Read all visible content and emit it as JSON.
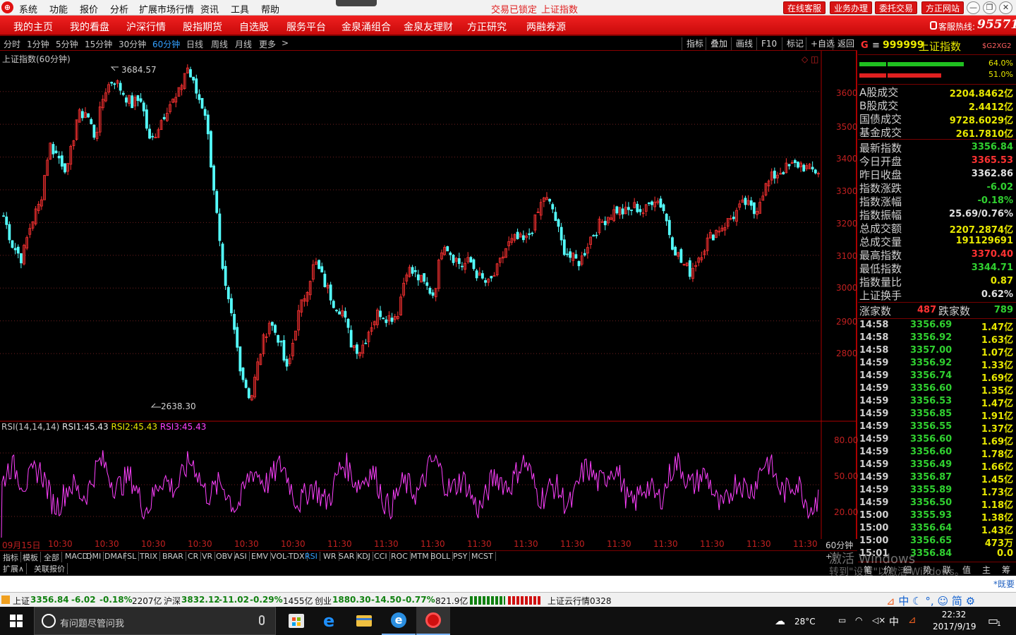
{
  "app": {
    "menu": [
      "系统",
      "功能",
      "报价",
      "分析",
      "扩展市场行情",
      "资讯",
      "工具",
      "帮助"
    ],
    "status_text": "交易已锁定",
    "index_name": "上证指数",
    "top_buttons": [
      "在线客服",
      "业务办理",
      "委托交易",
      "方正网站"
    ],
    "window_buttons": [
      "minimize",
      "restore",
      "close"
    ]
  },
  "nav": {
    "items": [
      "我的主页",
      "我的看盘",
      "沪深行情",
      "股指期货",
      "自选股",
      "服务平台",
      "金泉涌组合",
      "金泉友理财",
      "方正研究",
      "两融券源"
    ],
    "hotline_label": "客服热线:",
    "hotline_number": "95571"
  },
  "periods": {
    "items": [
      "分时",
      "1分钟",
      "5分钟",
      "15分钟",
      "30分钟",
      "60分钟",
      "日线",
      "周线",
      "月线",
      "更多"
    ],
    "active": "60分钟",
    "more_arrow": ">"
  },
  "tools": [
    "指标",
    "叠加",
    "画线",
    "F10",
    "标记",
    "+自选",
    "返回"
  ],
  "chart": {
    "title": "上证指数(60分钟)",
    "high_label": "3684.57",
    "low_label": "2638.30",
    "price_ticks": [
      "3600",
      "3500",
      "3400",
      "3300",
      "3200",
      "3100",
      "3000",
      "2900",
      "2800"
    ],
    "rsi_ticks": [
      "80.00",
      "50.00",
      "20.00"
    ],
    "rsi_label": "RSI(14,14,14)",
    "rsi1_label": "RSI1:",
    "rsi1": "45.43",
    "rsi2_label": "RSI2:",
    "rsi2": "45.43",
    "rsi3_label": "RSI3:",
    "rsi3": "45.43",
    "x_first": "09月15日",
    "x_labels": [
      "10:30",
      "10:30",
      "10:30",
      "10:30",
      "10:30",
      "10:30",
      "11:30",
      "11:30",
      "11:30",
      "11:30",
      "11:30",
      "11:30",
      "11:30",
      "11:30",
      "11:30",
      "11:30",
      "11:30"
    ],
    "x_period": "60分钟",
    "up_color": "#ff3232",
    "down_color": "#54ffff",
    "rsi_color": "#ff40ff"
  },
  "chart_data": {
    "type": "candlestick",
    "title": "上证指数(60分钟)",
    "ylim": [
      2600,
      3720
    ],
    "labeled_high": 3684.57,
    "labeled_low": 2638.3,
    "close_path": [
      3220,
      3130,
      3090,
      3200,
      3260,
      3440,
      3400,
      3360,
      3520,
      3540,
      3460,
      3600,
      3640,
      3600,
      3560,
      3580,
      3440,
      3500,
      3560,
      3580,
      3680,
      3600,
      3540,
      3300,
      3020,
      2900,
      2740,
      2660,
      2800,
      2900,
      2850,
      2740,
      2900,
      2990,
      3080,
      3020,
      2960,
      2930,
      2830,
      2810,
      2880,
      2930,
      2910,
      2920,
      3060,
      3040,
      3010,
      2980,
      3150,
      3100,
      3070,
      3080,
      3030,
      3010,
      3060,
      3130,
      3150,
      3140,
      3200,
      3280,
      3240,
      3130,
      3090,
      3080,
      3150,
      3190,
      3220,
      3240,
      3230,
      3250,
      3230,
      3280,
      3250,
      3140,
      3080,
      3050,
      3100,
      3150,
      3180,
      3200,
      3230,
      3260,
      3230,
      3300,
      3340,
      3360,
      3370,
      3380,
      3360,
      3356.84
    ],
    "rsi": {
      "ylim": [
        0,
        100
      ],
      "ticks": [
        20,
        50,
        80
      ],
      "current": 45.43
    }
  },
  "indicators": {
    "items": [
      "指标",
      "模板",
      "全部",
      "MACD",
      "DMI",
      "DMA",
      "FSL",
      "TRIX",
      "BRAR",
      "CR",
      "VR",
      "OBV",
      "ASI",
      "EMV",
      "VOL-TDX",
      "RSI",
      "WR",
      "SAR",
      "KDJ",
      "CCI",
      "ROC",
      "MTM",
      "BOLL",
      "PSY",
      "MCST"
    ],
    "active": "RSI",
    "plus": "+",
    "ext": [
      "扩展∧",
      "关联报价"
    ]
  },
  "right": {
    "code_prefix": "G",
    "code_menu": "≡",
    "code": "999999",
    "name": "上证指数",
    "badge": "$G2XG2",
    "bar1_value": "64.0%",
    "bar2_value": "51.0%",
    "volumes": [
      {
        "label": "A股成交",
        "value": "2204.8462亿"
      },
      {
        "label": "B股成交",
        "value": "2.4412亿"
      },
      {
        "label": "国债成交",
        "value": "9728.6029亿"
      },
      {
        "label": "基金成交",
        "value": "261.7810亿"
      }
    ],
    "stats": [
      {
        "label": "最新指数",
        "value": "3356.84",
        "color": "#30d030"
      },
      {
        "label": "今日开盘",
        "value": "3365.53",
        "color": "#ff3232"
      },
      {
        "label": "昨日收盘",
        "value": "3362.86",
        "color": "#e0e0e0"
      },
      {
        "label": "指数涨跌",
        "value": "-6.02",
        "color": "#30d030"
      },
      {
        "label": "指数涨幅",
        "value": "-0.18%",
        "color": "#30d030"
      },
      {
        "label": "指数振幅",
        "value": "25.69/0.76%",
        "color": "#e0e0e0"
      },
      {
        "label": "总成交额",
        "value": "2207.2874亿",
        "color": "#e8e800"
      },
      {
        "label": "总成交量",
        "value": "191129691",
        "color": "#e8e800"
      },
      {
        "label": "最高指数",
        "value": "3370.40",
        "color": "#ff3232"
      },
      {
        "label": "最低指数",
        "value": "3344.71",
        "color": "#30d030"
      },
      {
        "label": "指数量比",
        "value": "0.87",
        "color": "#e8e800"
      },
      {
        "label": "上证换手",
        "value": "0.62%",
        "color": "#e0e0e0"
      }
    ],
    "rise_label": "涨家数",
    "rise": "487",
    "fall_label": "跌家数",
    "fall": "789",
    "ticks": [
      {
        "t": "14:58",
        "p": "3356.69",
        "v": "1.47亿"
      },
      {
        "t": "14:58",
        "p": "3356.92",
        "v": "1.63亿"
      },
      {
        "t": "14:58",
        "p": "3357.00",
        "v": "1.07亿"
      },
      {
        "t": "14:59",
        "p": "3356.92",
        "v": "1.33亿"
      },
      {
        "t": "14:59",
        "p": "3356.74",
        "v": "1.69亿"
      },
      {
        "t": "14:59",
        "p": "3356.60",
        "v": "1.35亿"
      },
      {
        "t": "14:59",
        "p": "3356.53",
        "v": "1.47亿"
      },
      {
        "t": "14:59",
        "p": "3356.85",
        "v": "1.91亿"
      },
      {
        "t": "14:59",
        "p": "3356.55",
        "v": "1.37亿"
      },
      {
        "t": "14:59",
        "p": "3356.60",
        "v": "1.69亿"
      },
      {
        "t": "14:59",
        "p": "3356.60",
        "v": "1.78亿"
      },
      {
        "t": "14:59",
        "p": "3356.49",
        "v": "1.66亿"
      },
      {
        "t": "14:59",
        "p": "3356.87",
        "v": "1.45亿"
      },
      {
        "t": "14:59",
        "p": "3355.89",
        "v": "1.73亿"
      },
      {
        "t": "14:59",
        "p": "3356.50",
        "v": "1.18亿"
      },
      {
        "t": "15:00",
        "p": "3355.93",
        "v": "1.38亿"
      },
      {
        "t": "15:00",
        "p": "3356.64",
        "v": "1.43亿"
      },
      {
        "t": "15:00",
        "p": "3356.65",
        "v": "473万"
      },
      {
        "t": "15:01",
        "p": "3356.84",
        "v": "0.0"
      }
    ],
    "tabs": [
      "笔",
      "价",
      "细",
      "势",
      "联",
      "值",
      "主",
      "筹"
    ]
  },
  "watermark": {
    "line1": "激活 Windows",
    "line2": "转到\"设置\"以激活 Windows。"
  },
  "whitebar": {
    "more": "*既要"
  },
  "status": {
    "sh_name": "上证",
    "sh_price": "3356.84",
    "sh_chg": "-6.02",
    "sh_pct": "-0.18%",
    "sh_amt": "2207亿",
    "sz_name": "沪深",
    "sz_price": "3832.12",
    "sz_chg": "-11.02",
    "sz_pct": "-0.29%",
    "sz_amt": "1455亿",
    "cy_name": "创业",
    "cy_price": "1880.30",
    "cy_chg": "-14.50",
    "cy_pct": "-0.77%",
    "cy_amt": "821.9亿",
    "cloud": "上证云行情0328",
    "ime": [
      "中",
      "简"
    ]
  },
  "taskbar": {
    "search_placeholder": "有问题尽管问我",
    "temp": "28°C",
    "ime": "中",
    "time": "22:32",
    "date": "2017/9/19",
    "notify": "1"
  }
}
